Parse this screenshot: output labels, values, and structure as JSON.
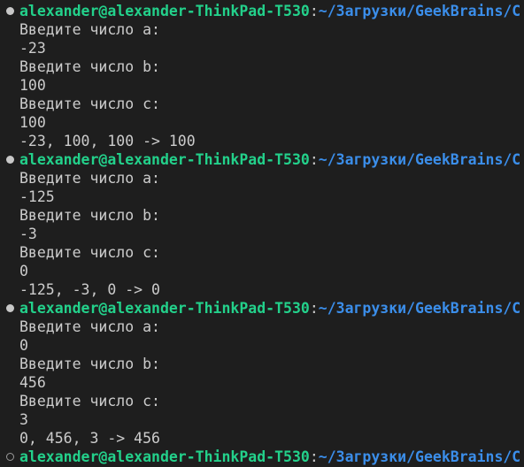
{
  "terminal": {
    "prompt": {
      "user_host": "alexander@alexander-ThinkPad-T530",
      "separator": ":",
      "path": "~/Загрузки/GeekBrains/C"
    },
    "runs": [
      {
        "status": "done",
        "lines": [
          "Введите число a:",
          "-23",
          "Введите число b:",
          "100",
          "Введите число c:",
          "100",
          "-23, 100, 100 -> 100"
        ]
      },
      {
        "status": "done",
        "lines": [
          "Введите число a:",
          "-125",
          "Введите число b:",
          "-3",
          "Введите число c:",
          "0",
          "-125, -3, 0 -> 0"
        ]
      },
      {
        "status": "done",
        "lines": [
          "Введите число a:",
          "0",
          "Введите число b:",
          "456",
          "Введите число c:",
          "3",
          "0, 456, 3 -> 456"
        ]
      },
      {
        "status": "idle",
        "lines": []
      }
    ]
  }
}
